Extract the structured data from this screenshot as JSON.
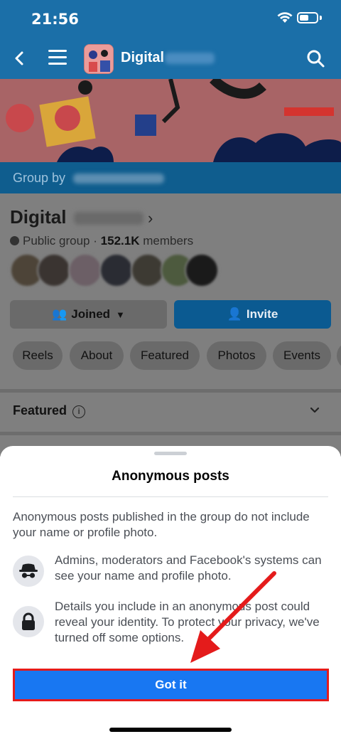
{
  "status": {
    "time": "21:56"
  },
  "nav": {
    "title": "Digital"
  },
  "group": {
    "group_by_label": "Group by",
    "name": "Digital",
    "privacy": "Public group",
    "separator": "·",
    "member_count": "152.1K",
    "members_label": "members",
    "joined_label": "Joined",
    "invite_label": "Invite"
  },
  "tabs": [
    "Reels",
    "About",
    "Featured",
    "Photos",
    "Events"
  ],
  "featured": {
    "title": "Featured"
  },
  "sheet": {
    "title": "Anonymous posts",
    "description": "Anonymous posts published in the group do not include your name or profile photo.",
    "items": [
      {
        "icon": "incognito-icon",
        "text": "Admins, moderators and Facebook's systems can see your name and profile photo."
      },
      {
        "icon": "lock-icon",
        "text": "Details you include in an anonymous post could reveal your identity. To protect your privacy, we've turned off some options."
      }
    ],
    "button_label": "Got it"
  },
  "colors": {
    "brand": "#1877f2",
    "header": "#1b6fa8",
    "highlight": "#e41b1b"
  }
}
